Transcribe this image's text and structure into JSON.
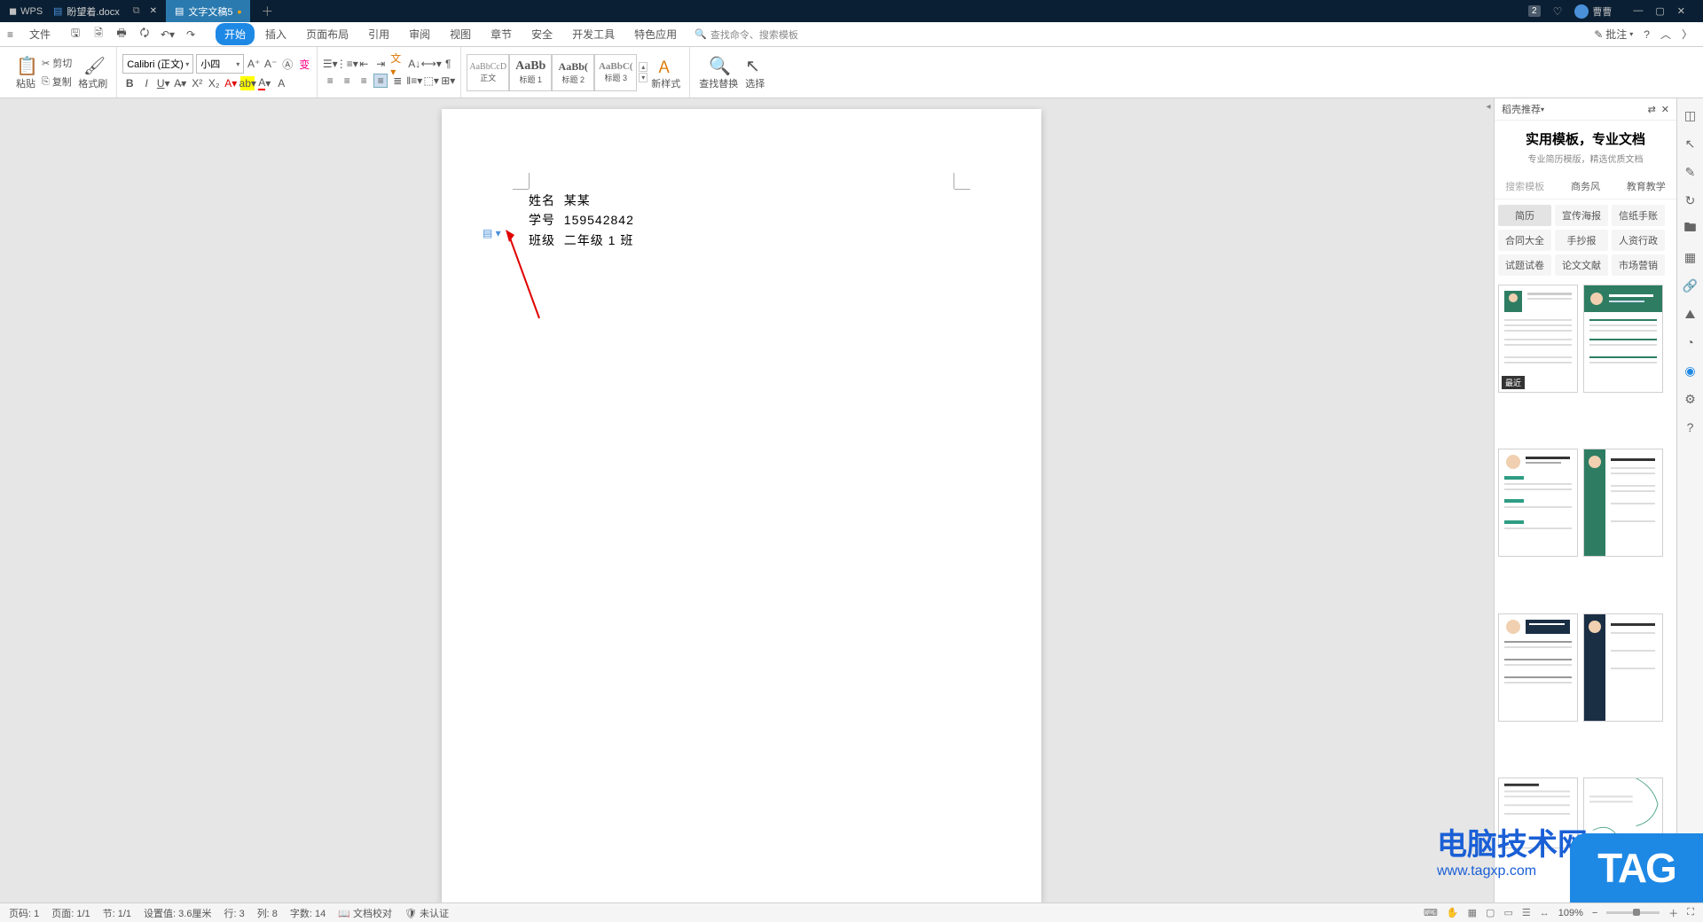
{
  "titlebar": {
    "app_name": "WPS",
    "tabs": [
      {
        "icon": "doc",
        "label": "盼望着.docx",
        "active": false
      },
      {
        "icon": "doc",
        "label": "文字文稿5",
        "active": true,
        "modified": true
      }
    ],
    "notification_badge": "2",
    "user_name": "曹曹"
  },
  "menubar": {
    "file_label": "文件",
    "tabs": [
      "开始",
      "插入",
      "页面布局",
      "引用",
      "审阅",
      "视图",
      "章节",
      "安全",
      "开发工具",
      "特色应用"
    ],
    "active_tab_index": 0,
    "search_placeholder": "查找命令、搜索模板",
    "right": {
      "comment": "批注"
    }
  },
  "ribbon": {
    "paste": "粘贴",
    "cut": "剪切",
    "copy": "复制",
    "format_painter": "格式刷",
    "font_name": "Calibri (正文)",
    "font_size": "小四",
    "styles": [
      {
        "name": "正文",
        "class": "p1",
        "sample": "AaBbCcD"
      },
      {
        "name": "标题 1",
        "class": "p2",
        "sample": "AaBb"
      },
      {
        "name": "标题 2",
        "class": "p3",
        "sample": "AaBb("
      },
      {
        "name": "标题 3",
        "class": "p4",
        "sample": "AaBbC("
      }
    ],
    "new_style": "新样式",
    "find_replace": "查找替换",
    "select": "选择"
  },
  "document": {
    "lines": [
      {
        "label": "姓名",
        "value": "某某"
      },
      {
        "label": "学号",
        "value": "159542842"
      },
      {
        "label": "班级",
        "value": "二年级 1 班"
      }
    ]
  },
  "rightpanel": {
    "header": "稻壳推荐",
    "title": "实用模板，专业文档",
    "subtitle": "专业简历模版，精选优质文档",
    "search_placeholder": "搜索模板",
    "tabs": [
      "商务风",
      "教育教学"
    ],
    "categories": [
      "简历",
      "宣传海报",
      "信纸手账",
      "合同大全",
      "手抄报",
      "人资行政",
      "试题试卷",
      "论文文献",
      "市场营销"
    ],
    "recent_badge": "最近"
  },
  "statusbar": {
    "page_no": "页码: 1",
    "page": "页面: 1/1",
    "section": "节: 1/1",
    "pos": "设置值: 3.6厘米",
    "row": "行: 3",
    "col": "列: 8",
    "words": "字数: 14",
    "proof": "文档校对",
    "cert": "未认证",
    "zoom": "109%"
  },
  "watermark": {
    "site_name": "电脑技术网",
    "site_url": "www.tagxp.com",
    "tag": "TAG"
  }
}
